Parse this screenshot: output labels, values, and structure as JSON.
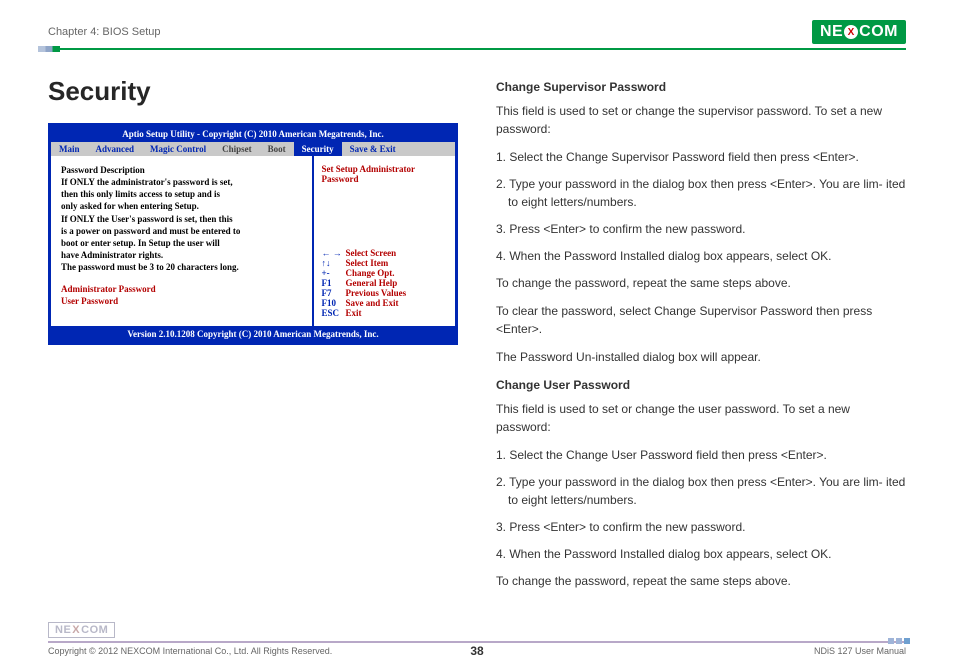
{
  "header": {
    "chapter": "Chapter 4: BIOS Setup",
    "logo_pre": "NE",
    "logo_x": "X",
    "logo_post": "COM"
  },
  "title": "Security",
  "bios": {
    "header": "Aptio  Setup  Utility - Copyright (C) 2010 American Megatrends, Inc.",
    "tabs": [
      "Main",
      "Advanced",
      "Magic Control",
      "Chipset",
      "Boot",
      "Security",
      "Save & Exit"
    ],
    "active_tab_index": 5,
    "main": {
      "heading": "Password Description",
      "l1": "If ONLY the administrator's password is set,",
      "l2": "then this only limits access to setup and is",
      "l3": "only asked for when entering Setup.",
      "l4": "If ONLY the User's password is set, then this",
      "l5": "is a power on password and must be entered to",
      "l6": "boot or enter setup. In Setup the user will",
      "l7": "have Administrator rights.",
      "l8": "The password must be 3 to 20 characters long.",
      "admin_pw": "Administrator Password",
      "user_pw": "User Password"
    },
    "side_top": "Set Setup Administrator Password",
    "legend": [
      {
        "k": "← →",
        "v": "Select Screen"
      },
      {
        "k": "↑↓",
        "v": "Select Item"
      },
      {
        "k": "+-",
        "v": "Change Opt."
      },
      {
        "k": "F1",
        "v": "General Help"
      },
      {
        "k": "F7",
        "v": "Previous Values"
      },
      {
        "k": "F10",
        "v": "Save and Exit"
      },
      {
        "k": "ESC",
        "v": "Exit"
      }
    ],
    "footer": "Version 2.10.1208 Copyright (C) 2010 American Megatrends, Inc."
  },
  "doc": {
    "h1": "Change Supervisor Password",
    "p1": "This field is used to set or change the supervisor password. To set a new password:",
    "s1_1": "1. Select the Change Supervisor Password field then press <Enter>.",
    "s1_2": "2. Type your password in the dialog box then press <Enter>. You are lim- ited to eight letters/numbers.",
    "s1_3": "3. Press <Enter> to confirm the new password.",
    "s1_4": "4. When the Password Installed dialog box appears, select OK.",
    "p2": "To change the password, repeat the same steps above.",
    "p3": "To clear the password, select Change Supervisor Password then press <Enter>.",
    "p4": "The Password Un-installed dialog box will appear.",
    "h2": "Change User Password",
    "p5": "This field is used to set or change the user password. To set a new password:",
    "s2_1": "1. Select the Change User Password field then press <Enter>.",
    "s2_2": "2. Type your password in the dialog box then press <Enter>. You are lim- ited to eight letters/numbers.",
    "s2_3": "3. Press <Enter> to confirm the new password.",
    "s2_4": "4. When the Password Installed dialog box appears, select OK.",
    "p6": "To change the password, repeat the same steps above."
  },
  "footer": {
    "logo_pre": "NE",
    "logo_x": "X",
    "logo_post": "COM",
    "copyright": "Copyright © 2012 NEXCOM International Co., Ltd. All Rights Reserved.",
    "page": "38",
    "manual": "NDiS 127 User Manual"
  }
}
